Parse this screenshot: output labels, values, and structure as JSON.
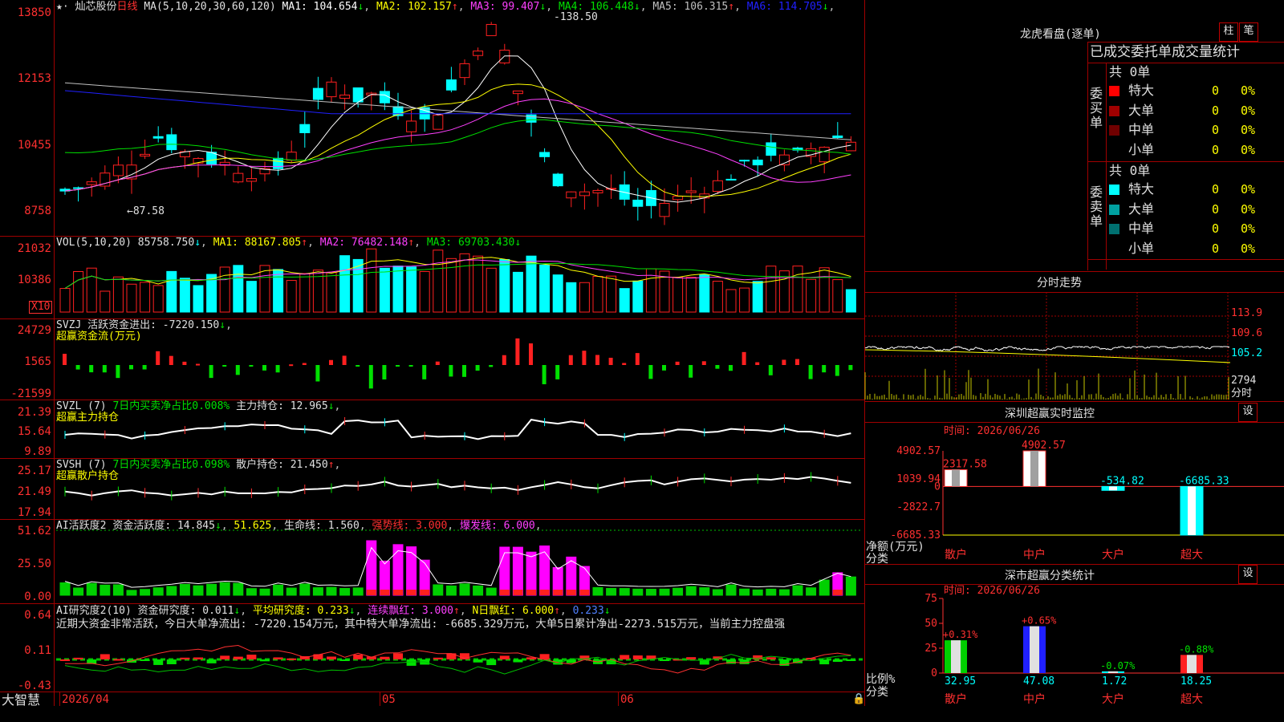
{
  "colors": {
    "up": "#ff2020",
    "down": "#00ffff",
    "ma1": "#ffffff",
    "ma2": "#ffff00",
    "ma3": "#ff40ff",
    "ma4": "#00e000",
    "ma5": "#c0c0c0",
    "ma6": "#2020ff",
    "grid": "#a00000"
  },
  "main": {
    "stock_name": "灿芯股份",
    "period": "日线",
    "ma_header": "MA(5,10,20,30,60,120)",
    "ma": [
      {
        "label": "MA1: 104.654",
        "arrow": "↓",
        "color": "#ffffff"
      },
      {
        "label": "MA2: 102.157",
        "arrow": "↑",
        "color": "#ffff00"
      },
      {
        "label": "MA3: 99.407",
        "arrow": "↓",
        "color": "#ff40ff"
      },
      {
        "label": "MA4: 106.448",
        "arrow": "↓",
        "color": "#00e000"
      },
      {
        "label": "MA5: 106.315",
        "arrow": "↑",
        "color": "#c0c0c0"
      },
      {
        "label": "MA6: 114.705",
        "arrow": "↓",
        "color": "#2020ff"
      }
    ],
    "y_ticks": [
      "13850",
      "12153",
      "10455",
      "8758"
    ],
    "high_label": "138.50",
    "low_label": "87.58"
  },
  "vol": {
    "header": "VOL(5,10,20)",
    "value": "85758.750",
    "ma1": "MA1: 88167.805",
    "ma2": "MA2: 76482.148",
    "ma3": "MA3: 69703.430",
    "y_ticks": [
      "21032",
      "10386"
    ],
    "unit": "X10"
  },
  "svzj": {
    "header": "SVZJ",
    "label": "活跃资金进出: -7220.150",
    "sub": "超赢资金流(万元)",
    "y_ticks": [
      "24729",
      "1565",
      "-21599"
    ]
  },
  "svzl": {
    "header": "SVZL (7)",
    "p1": "7日内买卖净占比0.008%",
    "p2": "主力持仓: 12.965",
    "sub": "超赢主力持仓",
    "y_ticks": [
      "21.39",
      "15.64",
      "9.89"
    ]
  },
  "svsh": {
    "header": "SVSH (7)",
    "p1": "7日内买卖净占比0.098%",
    "p2": "散户持仓: 21.450",
    "sub": "超赢散户持仓",
    "y_ticks": [
      "25.17",
      "21.49",
      "17.94"
    ]
  },
  "ai1": {
    "header": "AI活跃度2",
    "p1": "资金活跃度: 14.845",
    "p2": "51.625",
    "p3": "生命线: 1.560",
    "p4": "强势线: 3.000",
    "p5": "爆发线: 6.000",
    "y_ticks": [
      "51.62",
      "25.50",
      "0.00"
    ]
  },
  "ai2": {
    "header": "AI研究度2(10)",
    "p1": "资金研究度: 0.011",
    "p2": "平均研究度: 0.233",
    "p3": "连续飘红: 3.000",
    "p4": "N日飘红: 6.000",
    "p5": "0.233",
    "text": "近期大资金非常活跃，今日大单净流出: -7220.154万元，其中特大单净流出: -6685.329万元，大单5日累计净出-2273.515万元，当前主力控盘强",
    "y_ticks": [
      "0.64",
      "0.11",
      "-0.43"
    ]
  },
  "footer": {
    "app": "大智慧",
    "d1": "2026/04",
    "d2": "05",
    "d3": "06"
  },
  "lhb": {
    "title": "龙虎看盘(逐单)",
    "btn1": "柱",
    "btn2": "笔",
    "subtitle": "已成交委托单成交量统计",
    "buy": {
      "side": "委买单",
      "total": "共 0单",
      "rows": [
        {
          "name": "特大",
          "val": "0",
          "pct": "0%",
          "color": "#ff0000"
        },
        {
          "name": "大单",
          "val": "0",
          "pct": "0%",
          "color": "#a00000"
        },
        {
          "name": "中单",
          "val": "0",
          "pct": "0%",
          "color": "#700000"
        },
        {
          "name": "小单",
          "val": "0",
          "pct": "0%",
          "color": "#000000"
        }
      ]
    },
    "sell": {
      "side": "委卖单",
      "total": "共 0单",
      "rows": [
        {
          "name": "特大",
          "val": "0",
          "pct": "0%",
          "color": "#00ffff"
        },
        {
          "name": "大单",
          "val": "0",
          "pct": "0%",
          "color": "#00a0a0"
        },
        {
          "name": "中单",
          "val": "0",
          "pct": "0%",
          "color": "#007070"
        },
        {
          "name": "小单",
          "val": "0",
          "pct": "0%",
          "color": "#000000"
        }
      ]
    }
  },
  "fenshi": {
    "title": "分时走势",
    "y_ticks": [
      "113.9",
      "109.6",
      "105.2",
      "2794"
    ],
    "unit": "分时"
  },
  "sz_monitor": {
    "title": "深圳超赢实时监控",
    "btn": "设",
    "time": "时间: 2026/06/26",
    "y_ticks": [
      "4902.57",
      "1039.94",
      "0",
      "-2822.7",
      "-6685.33"
    ],
    "ylabel1": "净额(万元)",
    "ylabel2": "分类",
    "chart_data": {
      "type": "bar",
      "categories": [
        "散户",
        "中户",
        "大户",
        "超大"
      ],
      "values": [
        2317.58,
        4902.57,
        -534.82,
        -6685.33
      ],
      "labels": [
        "2317.58",
        "4902.57",
        "-534.82",
        "-6685.33"
      ],
      "ylim": [
        -6685.33,
        4902.57
      ]
    }
  },
  "sz_stats": {
    "title": "深市超赢分类统计",
    "btn": "设",
    "time": "时间: 2026/06/26",
    "y_ticks": [
      "75",
      "50",
      "25",
      "0"
    ],
    "ylabel1": "比例%",
    "ylabel2": "分类",
    "chart_data": {
      "type": "bar",
      "categories": [
        "散户",
        "中户",
        "大户",
        "超大"
      ],
      "values": [
        32.95,
        47.08,
        1.72,
        18.25
      ],
      "changes": [
        "+0.31%",
        "+0.65%",
        "-0.07%",
        "-0.88%"
      ],
      "ylim": [
        0,
        75
      ]
    }
  }
}
